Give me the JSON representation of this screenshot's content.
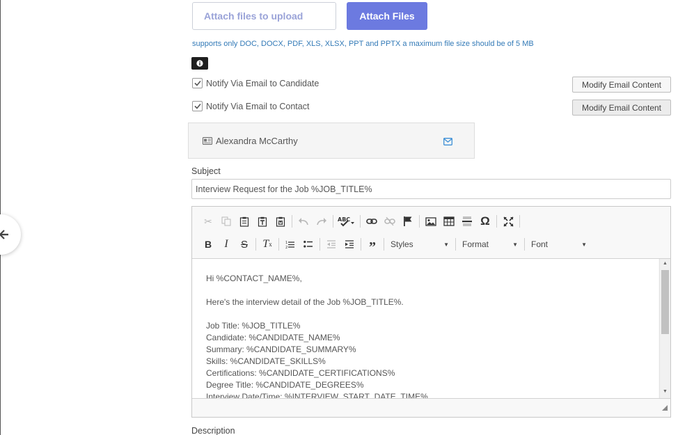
{
  "upload": {
    "placeholder": "Attach files to upload",
    "button_label": "Attach Files",
    "support_text": "supports only DOC, DOCX, PDF, XLS, XLSX, PPT and PPTX a maximum file size should be of 5 MB"
  },
  "notifications": [
    {
      "label": "Notify Via Email to Candidate",
      "checked": true,
      "button_label": "Modify Email Content"
    },
    {
      "label": "Notify Via Email to Contact",
      "checked": true,
      "button_label": "Modify Email Content"
    }
  ],
  "contact": {
    "name": "Alexandra McCarthy"
  },
  "subject": {
    "label": "Subject",
    "value": "Interview Request for the Job %JOB_TITLE%"
  },
  "editor": {
    "combos": {
      "styles": "Styles",
      "format": "Format",
      "font": "Font"
    },
    "lines": [
      "Hi %CONTACT_NAME%,",
      "",
      "Here's the interview detail of the Job %JOB_TITLE%.",
      "",
      "Job Title: %JOB_TITLE%",
      "Candidate: %CANDIDATE_NAME%",
      "Summary: %CANDIDATE_SUMMARY%",
      "Skills: %CANDIDATE_SKILLS%",
      "Certifications: %CANDIDATE_CERTIFICATIONS%",
      "Degree Title: %CANDIDATE_DEGREES%",
      "Interview Date/Time: %INTERVIEW_START_DATE_TIME%"
    ]
  },
  "description": {
    "label": "Description"
  },
  "colors": {
    "accent": "#6c7ae0",
    "link": "#337ab7"
  }
}
